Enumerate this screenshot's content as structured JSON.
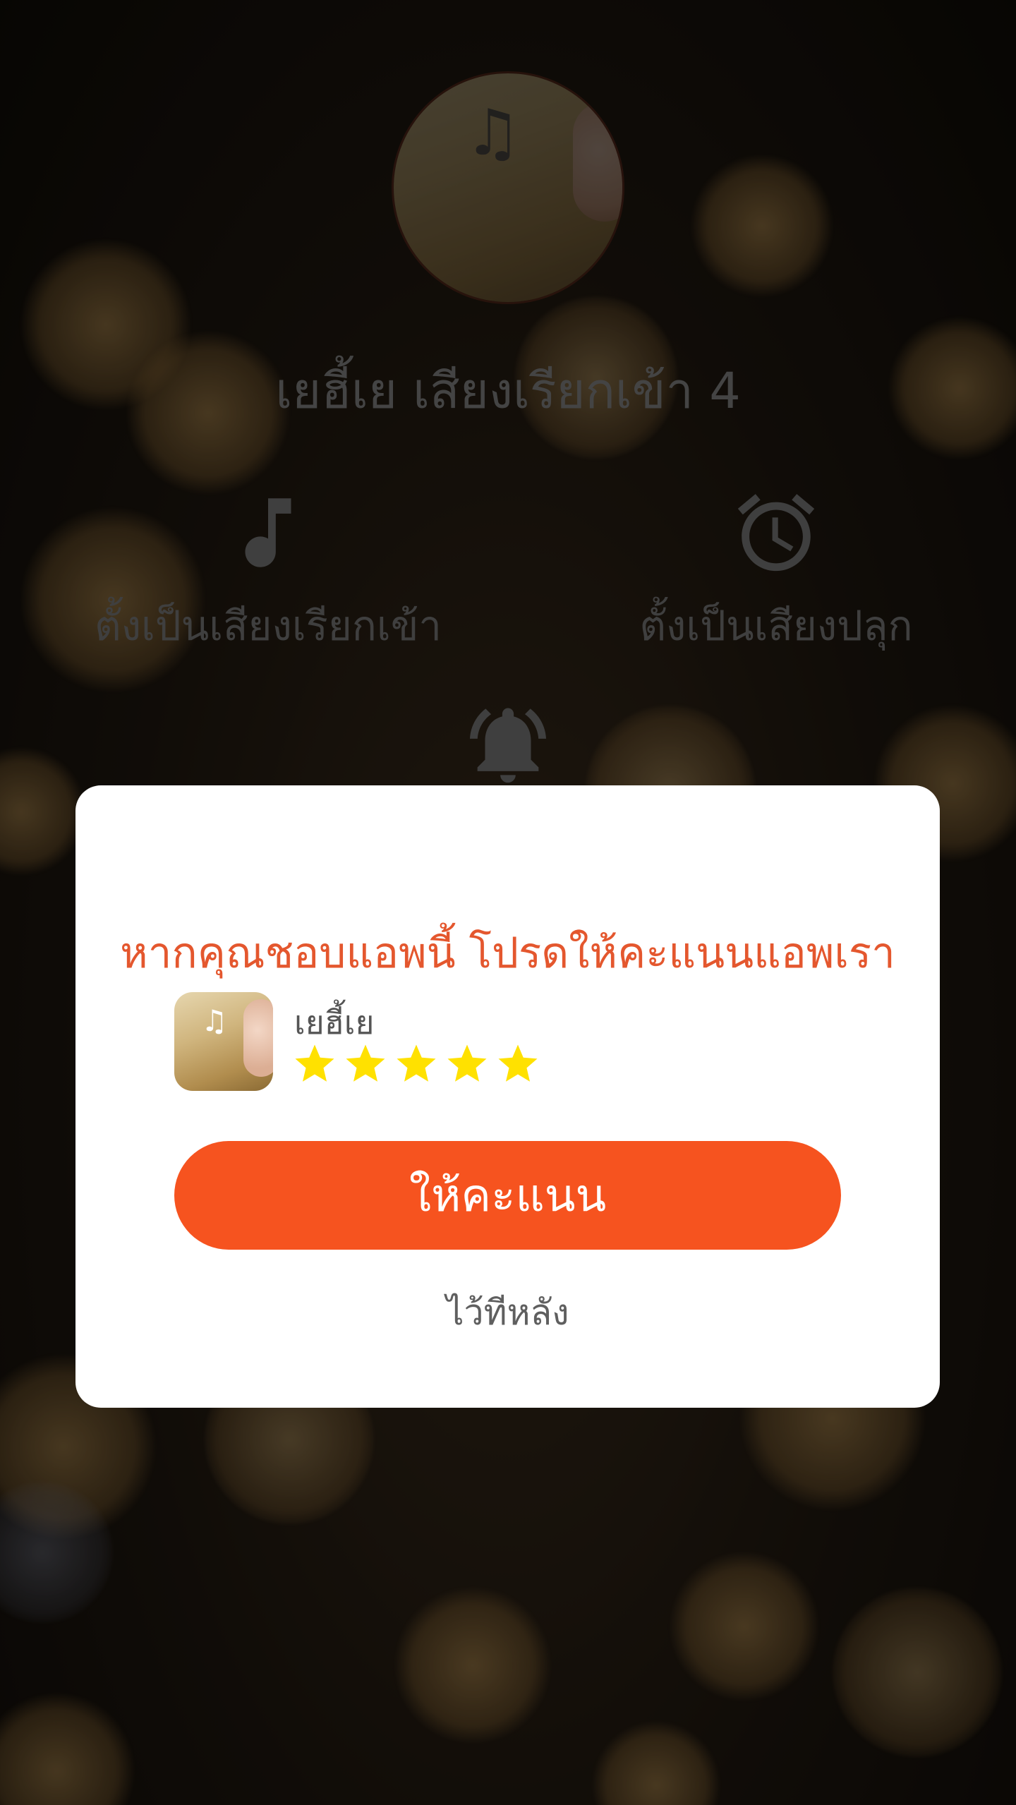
{
  "song": {
    "title": "เยฮี้เย เสียงเรียกเข้า 4"
  },
  "actions": {
    "set_ringtone": "ตั้งเป็นเสียงเรียกเข้า",
    "set_alarm": "ตั้งเป็นเสียงปลุก"
  },
  "dialog": {
    "heading": "หากคุณชอบแอพนี้ โปรดให้คะแนนแอพเรา",
    "app_name": "เยฮี้เย",
    "rating": 5,
    "rate_button": "ให้คะแนน",
    "later_button": "ไว้ทีหลัง"
  },
  "colors": {
    "accent": "#f6531f",
    "heading": "#e4572e",
    "star": "#ffe100"
  }
}
